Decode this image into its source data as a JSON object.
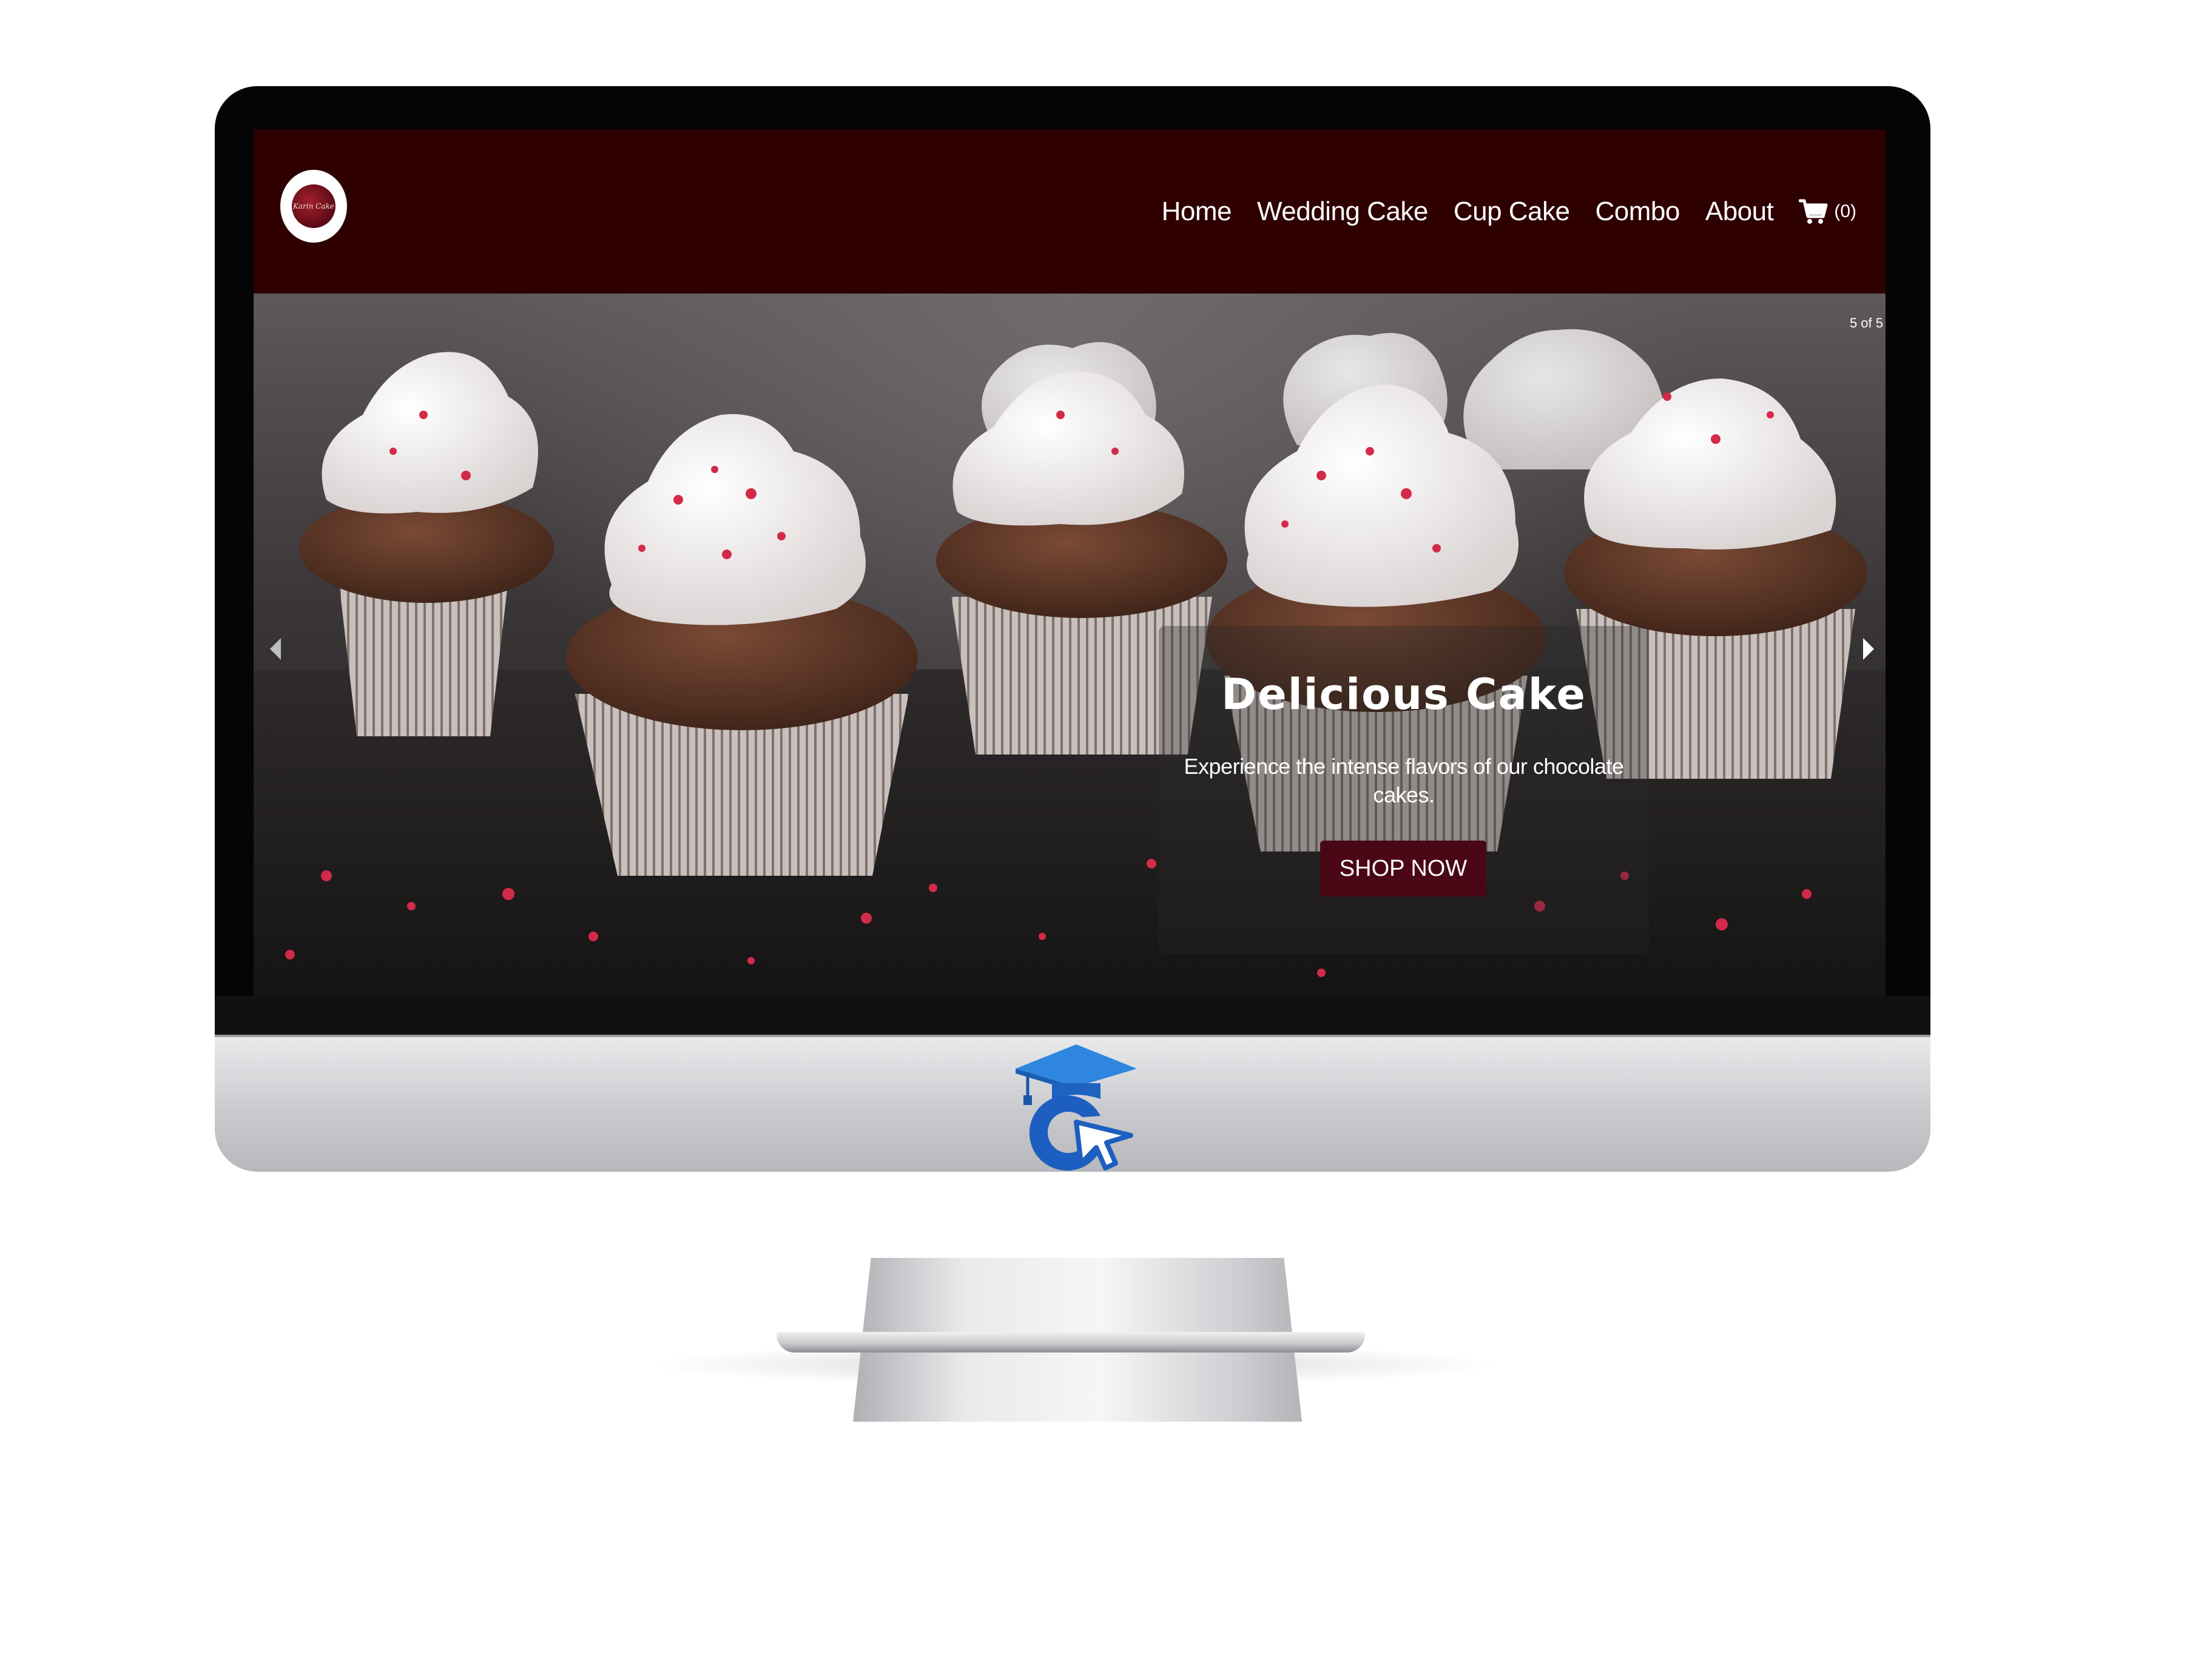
{
  "site": {
    "logo_text": "Karin Cake",
    "nav": [
      {
        "label": "Home"
      },
      {
        "label": "Wedding Cake"
      },
      {
        "label": "Cup Cake"
      },
      {
        "label": "Combo"
      },
      {
        "label": "About"
      }
    ],
    "cart_count": "(0)"
  },
  "hero": {
    "slide_counter": "5 of 5",
    "title": "Delicious Cake",
    "text": "Experience the intense flavors of our chocolate cakes.",
    "button_label": "SHOP NOW"
  },
  "colors": {
    "header_bg": "#2e0000",
    "button_bg": "#4a0716",
    "frosting": "#f4f0ef",
    "sprinkle": "#d42a4a",
    "brand_blue": "#1f6fd6"
  },
  "icons": [
    "cart-icon",
    "chevron-left-icon",
    "chevron-right-icon",
    "graduation-cap-icon",
    "cursor-icon"
  ]
}
